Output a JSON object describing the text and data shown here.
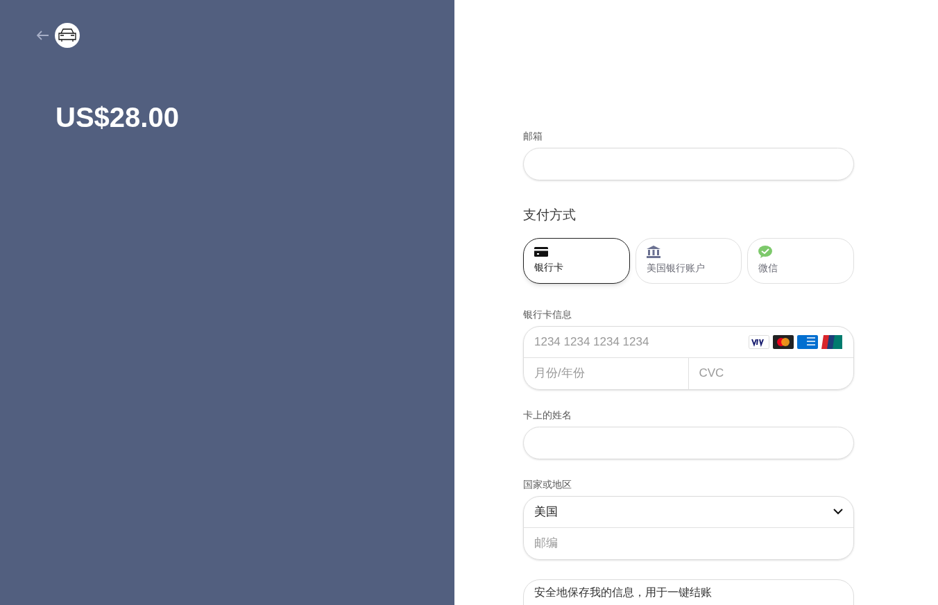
{
  "summary": {
    "amount": "US$28.00"
  },
  "form": {
    "email": {
      "label": "邮箱"
    },
    "payment_method": {
      "title": "支付方式",
      "options": [
        {
          "kind": "card",
          "label": "银行卡",
          "selected": true
        },
        {
          "kind": "bank",
          "label": "美国银行账户",
          "selected": false
        },
        {
          "kind": "wechat",
          "label": "微信",
          "selected": false
        }
      ]
    },
    "card_info": {
      "label": "银行卡信息",
      "number_placeholder": "1234 1234 1234 1234",
      "expiry_placeholder": "月份/年份",
      "cvc_placeholder": "CVC"
    },
    "name_on_card": {
      "label": "卡上的姓名"
    },
    "country": {
      "label": "国家或地区",
      "value": "美国",
      "zip_placeholder": "邮编"
    },
    "save_info": {
      "title": "安全地保存我的信息，用于一键结账"
    }
  }
}
